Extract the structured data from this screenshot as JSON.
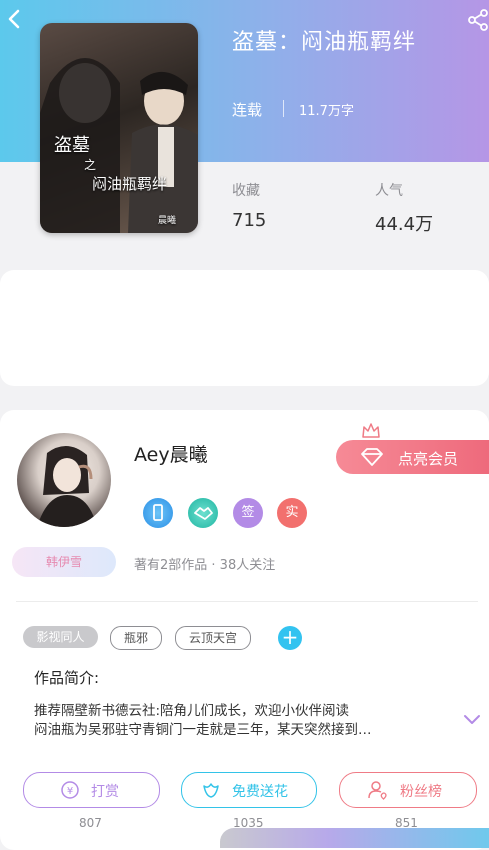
{
  "book": {
    "title": "盗墓：闷油瓶羁绊",
    "status": "连载",
    "word_count": "11.7万字",
    "cover_title_1": "盗墓",
    "cover_title_2": "之",
    "cover_title_3": "闷油瓶羁绊",
    "cover_credit": "晨曦"
  },
  "stats": {
    "favorites_label": "收藏",
    "favorites_value": "715",
    "popularity_label": "人气",
    "popularity_value": "44.4万"
  },
  "author": {
    "name": "Aey晨曦",
    "vip_button": "点亮会员",
    "badges": [
      {
        "icon": "phone-badge-icon",
        "color": "#3aa8f0"
      },
      {
        "icon": "handshake-badge-icon",
        "color": "#2fc7b4"
      },
      {
        "text": "签",
        "color": "#b38be6"
      },
      {
        "text": "实",
        "color": "#f2706e"
      }
    ],
    "fan_tag": "韩伊雪",
    "works_summary": "著有2部作品 · 38人关注"
  },
  "tags": [
    {
      "label": "影视同人",
      "style": "filled"
    },
    {
      "label": "瓶邪",
      "style": "outline"
    },
    {
      "label": "云顶天宫",
      "style": "outline"
    }
  ],
  "intro": {
    "heading": "作品简介:",
    "line1": "推荐隔壁新书德云社:陪角儿们成长，欢迎小伙伴阅读",
    "line2": "闷油瓶为吴邪驻守青铜门一走就是三年，某天突然接到…"
  },
  "actions": [
    {
      "label": "打赏",
      "count": "807",
      "color": "#b38be6",
      "icon": "coin-icon"
    },
    {
      "label": "免费送花",
      "count": "1035",
      "color": "#33c3e8",
      "icon": "flower-icon"
    },
    {
      "label": "粉丝榜",
      "count": "851",
      "color": "#ef7b86",
      "icon": "fan-rank-icon"
    }
  ]
}
